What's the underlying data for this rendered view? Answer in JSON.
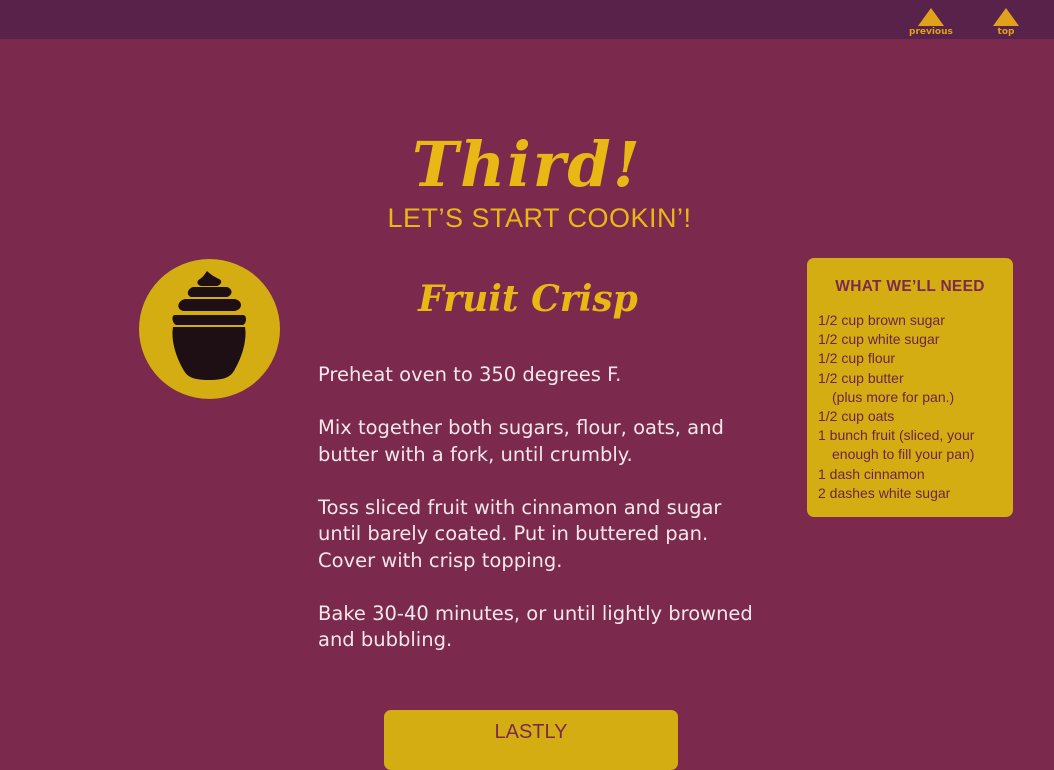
{
  "nav": {
    "previous_label": "previous",
    "top_label": "top",
    "arrow_color": "#e0a21a"
  },
  "section": {
    "title": "Third!",
    "subtitle": "LET’S START COOKIN’!"
  },
  "recipe": {
    "icon": "cupcake-icon",
    "title": "Fruit Crisp",
    "steps": [
      "Preheat oven to 350 degrees F.",
      "Mix together both sugars, flour, oats, and butter with a fork, until crumbly.",
      "Toss sliced fruit with cinnamon and sugar until barely coated. Put in buttered pan. Cover with crisp topping.",
      "Bake 30-40 minutes, or until lightly browned and bubbling."
    ]
  },
  "ingredients": {
    "heading": "WHAT WE’LL NEED",
    "items": [
      "1/2 cup brown sugar",
      "1/2 cup white sugar",
      "1/2 cup flour",
      "1/2 cup butter",
      "(plus more for pan.)",
      "1/2 cup oats",
      "1 bunch fruit (sliced, your",
      "enough to fill your pan)",
      "1 dash cinnamon",
      "2 dashes white sugar"
    ]
  },
  "next_section": {
    "label": "LASTLY"
  },
  "colors": {
    "background": "#7b2a4e",
    "topbar": "#58224a",
    "accent_yellow": "#e8b914",
    "card_yellow": "#d4ad12",
    "body_text": "#f2e6ea"
  }
}
